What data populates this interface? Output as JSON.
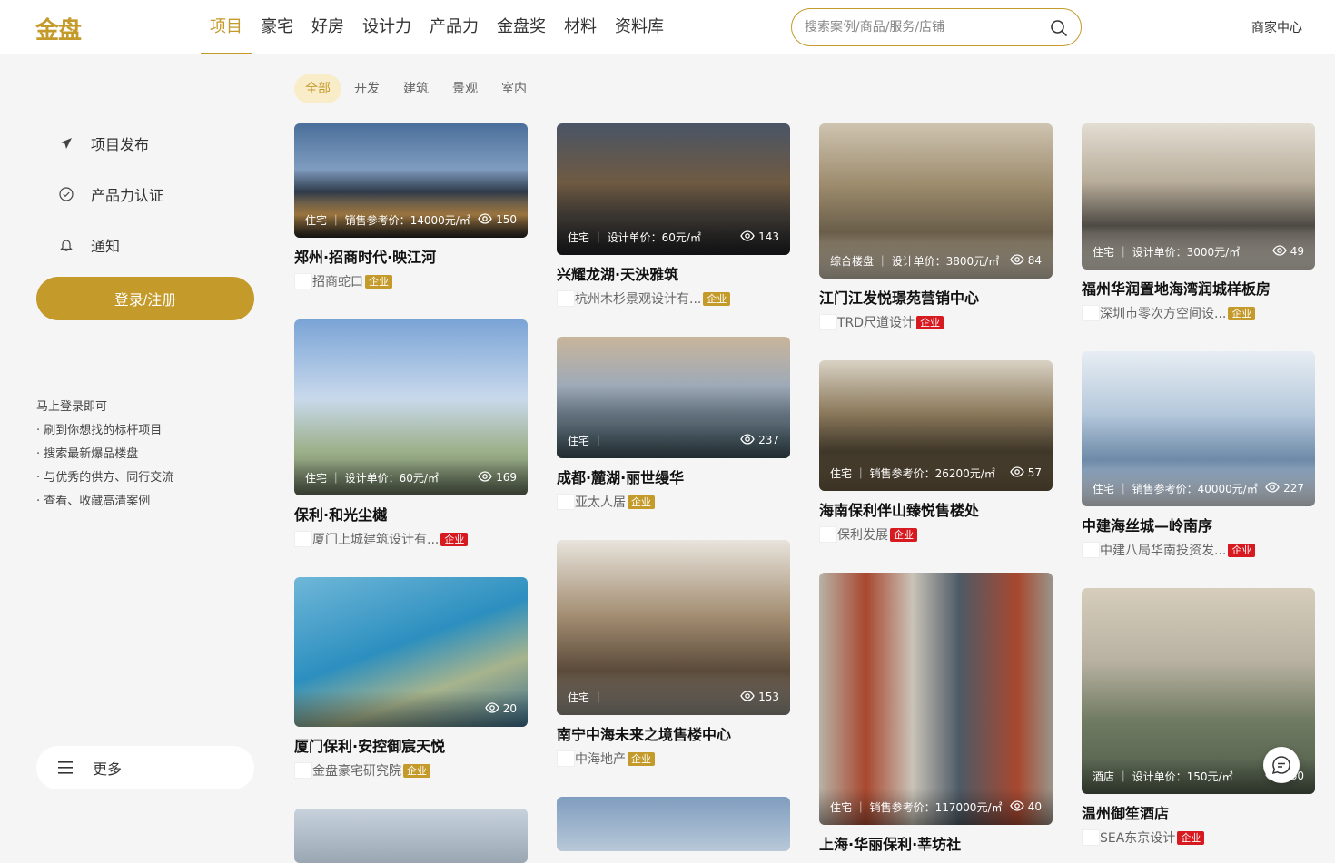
{
  "header": {
    "logo": "金盘",
    "nav": [
      "项目",
      "豪宅",
      "好房",
      "设计力",
      "产品力",
      "金盘奖",
      "材料",
      "资料库"
    ],
    "search_placeholder": "搜索案例/商品/服务/店铺",
    "merchant": "商家中心"
  },
  "sidebar": {
    "items": [
      {
        "label": "项目发布",
        "icon": "send-icon"
      },
      {
        "label": "产品力认证",
        "icon": "check-circle-icon"
      },
      {
        "label": "通知",
        "icon": "bell-icon"
      }
    ],
    "login": "登录/注册",
    "tips": [
      "马上登录即可",
      "· 刷到你想找的标杆项目",
      "· 搜索最新爆品楼盘",
      "· 与优秀的供方、同行交流",
      "· 查看、收藏高清案例"
    ],
    "more": "更多"
  },
  "filters": [
    "全部",
    "开发",
    "建筑",
    "景观",
    "室内"
  ],
  "colors": {
    "accent": "#c49a2a",
    "badge_gold": "#c49a2a",
    "badge_red": "#d71920"
  },
  "cards": [
    {
      "meta": "住宅 ｜ 销售参考价：14000元/㎡",
      "views": "150",
      "title": "郑州·招商时代·映江河",
      "company": "招商蛇口",
      "badge": "企业",
      "badge_color": "#c49a2a"
    },
    {
      "meta": "住宅 ｜ 设计单价：60元/㎡",
      "views": "169",
      "title": "保利·和光尘樾",
      "company": "厦门上城建筑设计有...",
      "badge": "企业",
      "badge_color": "#d71920"
    },
    {
      "meta": "",
      "views": "20",
      "title": "厦门保利·安控御宸天悦",
      "company": "金盘豪宅研究院",
      "badge": "企业",
      "badge_color": "#c49a2a"
    },
    {
      "meta": "住宅 ｜ 设计单价：60元/㎡",
      "views": "143",
      "title": "兴耀龙湖·天泱雅筑",
      "company": "杭州木杉景观设计有...",
      "badge": "企业",
      "badge_color": "#c49a2a"
    },
    {
      "meta": "住宅 ｜",
      "views": "237",
      "title": "成都·麓湖·丽世缦华",
      "company": "亚太人居",
      "badge": "企业",
      "badge_color": "#c49a2a"
    },
    {
      "meta": "住宅 ｜",
      "views": "153",
      "title": "南宁中海未来之境售楼中心",
      "company": "中海地产",
      "badge": "企业",
      "badge_color": "#c49a2a"
    },
    {
      "meta": "综合楼盘 ｜ 设计单价：3800元/㎡",
      "views": "84",
      "title": "江门江发悦璟苑营销中心",
      "company": "TRD尺道设计",
      "badge": "企业",
      "badge_color": "#d71920"
    },
    {
      "meta": "住宅 ｜ 销售参考价：26200元/㎡",
      "views": "57",
      "title": "海南保利伴山臻悦售楼处",
      "company": "保利发展",
      "badge": "企业",
      "badge_color": "#d71920"
    },
    {
      "meta": "住宅 ｜ 销售参考价：117000元/㎡",
      "views": "40",
      "title": "上海·华丽保利·莘坊社",
      "company": "",
      "badge": "",
      "badge_color": "#d71920"
    },
    {
      "meta": "住宅 ｜ 设计单价：3000元/㎡",
      "views": "49",
      "title": "福州华润置地海湾润城样板房",
      "company": "深圳市零次方空间设...",
      "badge": "企业",
      "badge_color": "#c49a2a"
    },
    {
      "meta": "住宅 ｜ 销售参考价：40000元/㎡",
      "views": "227",
      "title": "中建海丝城—岭南序",
      "company": "中建八局华南投资发...",
      "badge": "企业",
      "badge_color": "#d71920"
    },
    {
      "meta": "酒店 ｜ 设计单价：150元/㎡",
      "views": "160",
      "title": "温州御笙酒店",
      "company": "SEA东京设计",
      "badge": "企业",
      "badge_color": "#d71920"
    }
  ]
}
